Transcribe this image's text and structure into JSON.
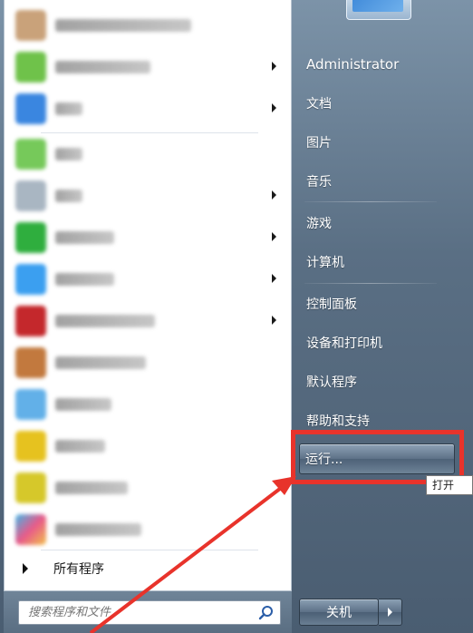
{
  "left": {
    "programs": [
      {
        "icon": "app-icon",
        "color": "#c9a27a"
      },
      {
        "icon": "app-icon",
        "color": "#6fc24a",
        "submenu": true
      },
      {
        "icon": "app-icon",
        "color": "#3a86e0",
        "submenu": true
      },
      {
        "icon": "app-icon",
        "color": "#76c95a"
      },
      {
        "icon": "app-icon",
        "color": "#a9b6c2",
        "submenu": true
      },
      {
        "icon": "app-icon",
        "color": "#2fae3e",
        "submenu": true
      },
      {
        "icon": "app-icon",
        "color": "#3b9ff0",
        "submenu": true
      },
      {
        "icon": "app-icon",
        "color": "#c4282c",
        "submenu": true
      },
      {
        "icon": "app-icon",
        "color": "#c2793e"
      },
      {
        "icon": "app-icon",
        "color": "#62b0e8"
      },
      {
        "icon": "app-icon",
        "color": "#e6c21f"
      },
      {
        "icon": "app-icon",
        "color": "#d6c82a"
      },
      {
        "icon": "app-icon",
        "color": "#e85a8a"
      }
    ],
    "all_programs": "所有程序"
  },
  "search": {
    "placeholder": "搜索程序和文件"
  },
  "right": {
    "user": "Administrator",
    "documents": "文档",
    "pictures": "图片",
    "music": "音乐",
    "games": "游戏",
    "computer": "计算机",
    "control_panel": "控制面板",
    "devices_printers": "设备和打印机",
    "default_programs": "默认程序",
    "help_support": "帮助和支持",
    "run": "运行..."
  },
  "tooltip": "打开",
  "shutdown": "关机",
  "colors": {
    "annotation": "#e8332b"
  }
}
